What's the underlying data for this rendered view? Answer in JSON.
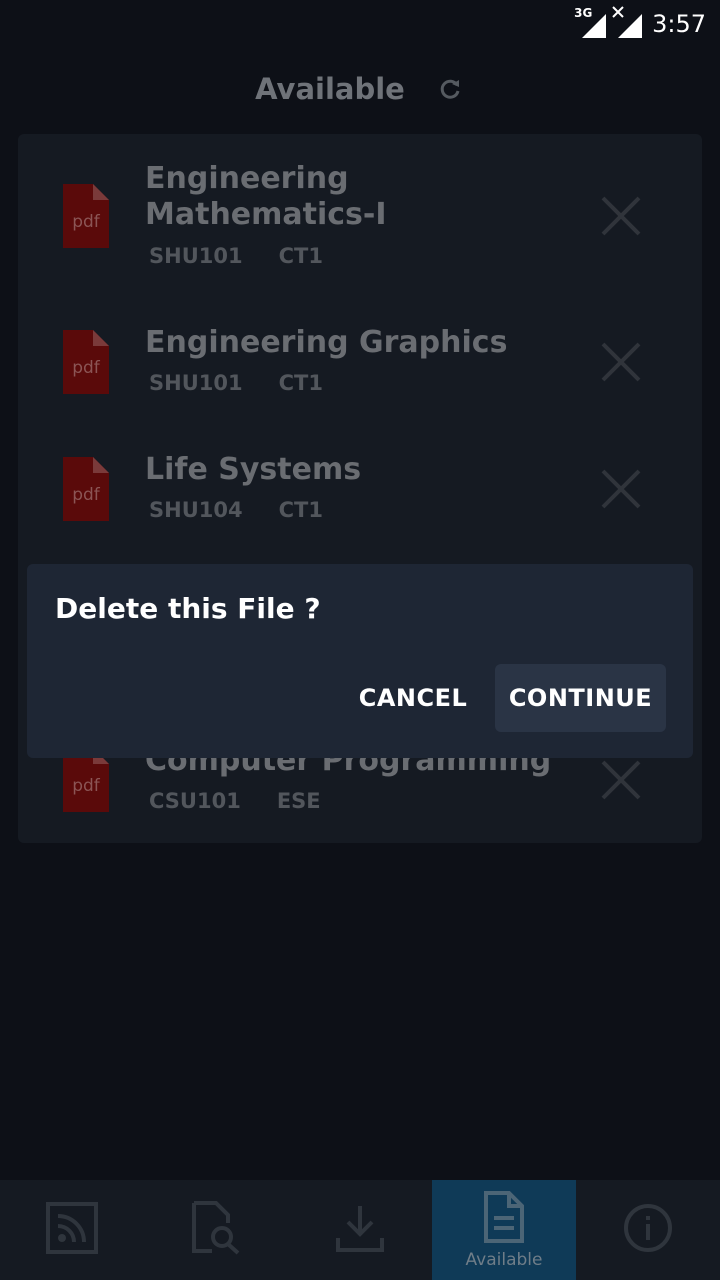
{
  "status_bar": {
    "network": "3G",
    "time": "3:57"
  },
  "header": {
    "title": "Available",
    "refresh_icon": "refresh-icon"
  },
  "files": [
    {
      "title": "Engineering Mathematics-I",
      "code": "SHU101",
      "exam": "CT1",
      "icon_text": "pdf"
    },
    {
      "title": "Engineering Graphics",
      "code": "SHU101",
      "exam": "CT1",
      "icon_text": "pdf"
    },
    {
      "title": "Life Systems",
      "code": "SHU104",
      "exam": "CT1",
      "icon_text": "pdf"
    },
    {
      "title": "Computer Programming",
      "code": "CSU101",
      "exam": "ESE",
      "icon_text": "pdf"
    }
  ],
  "dialog": {
    "title": "Delete this File ?",
    "cancel_label": "CANCEL",
    "continue_label": "CONTINUE"
  },
  "bottom_nav": {
    "items": [
      {
        "icon": "feed-icon",
        "label": ""
      },
      {
        "icon": "search-document-icon",
        "label": ""
      },
      {
        "icon": "download-icon",
        "label": ""
      },
      {
        "icon": "document-icon",
        "label": "Available",
        "active": true
      },
      {
        "icon": "info-icon",
        "label": ""
      }
    ]
  },
  "colors": {
    "background": "#0d1017",
    "dialog": "#1e2634",
    "active_tab": "#0f3a57",
    "pdf_red": "#5a0a0a"
  }
}
